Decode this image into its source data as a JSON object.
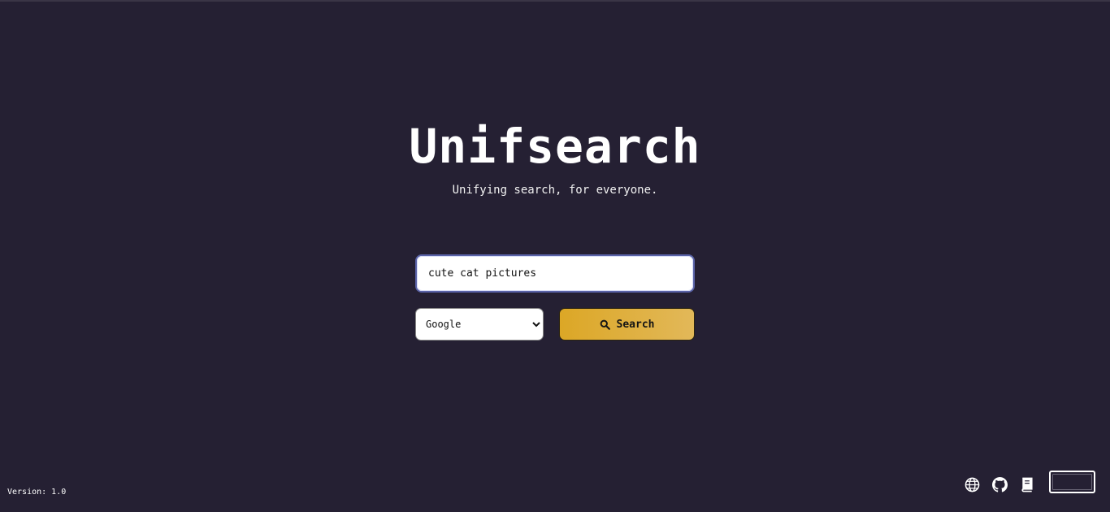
{
  "app": {
    "title": "Unifsearch",
    "tagline": "Unifying search, for everyone."
  },
  "search": {
    "value": "cute cat pictures",
    "placeholder": "",
    "engine_selected": "Google",
    "button_label": "Search",
    "button_icon": "magnifier-icon",
    "accent_color": "#dca726"
  },
  "footer": {
    "version_label": "Version:",
    "version_value": "1.0",
    "icons": [
      "globe-icon",
      "github-icon",
      "book-icon"
    ],
    "theme_toggle": "theme-toggle"
  },
  "colors": {
    "background": "#252033",
    "text": "#ffffff",
    "input_border": "#5a63a8"
  }
}
